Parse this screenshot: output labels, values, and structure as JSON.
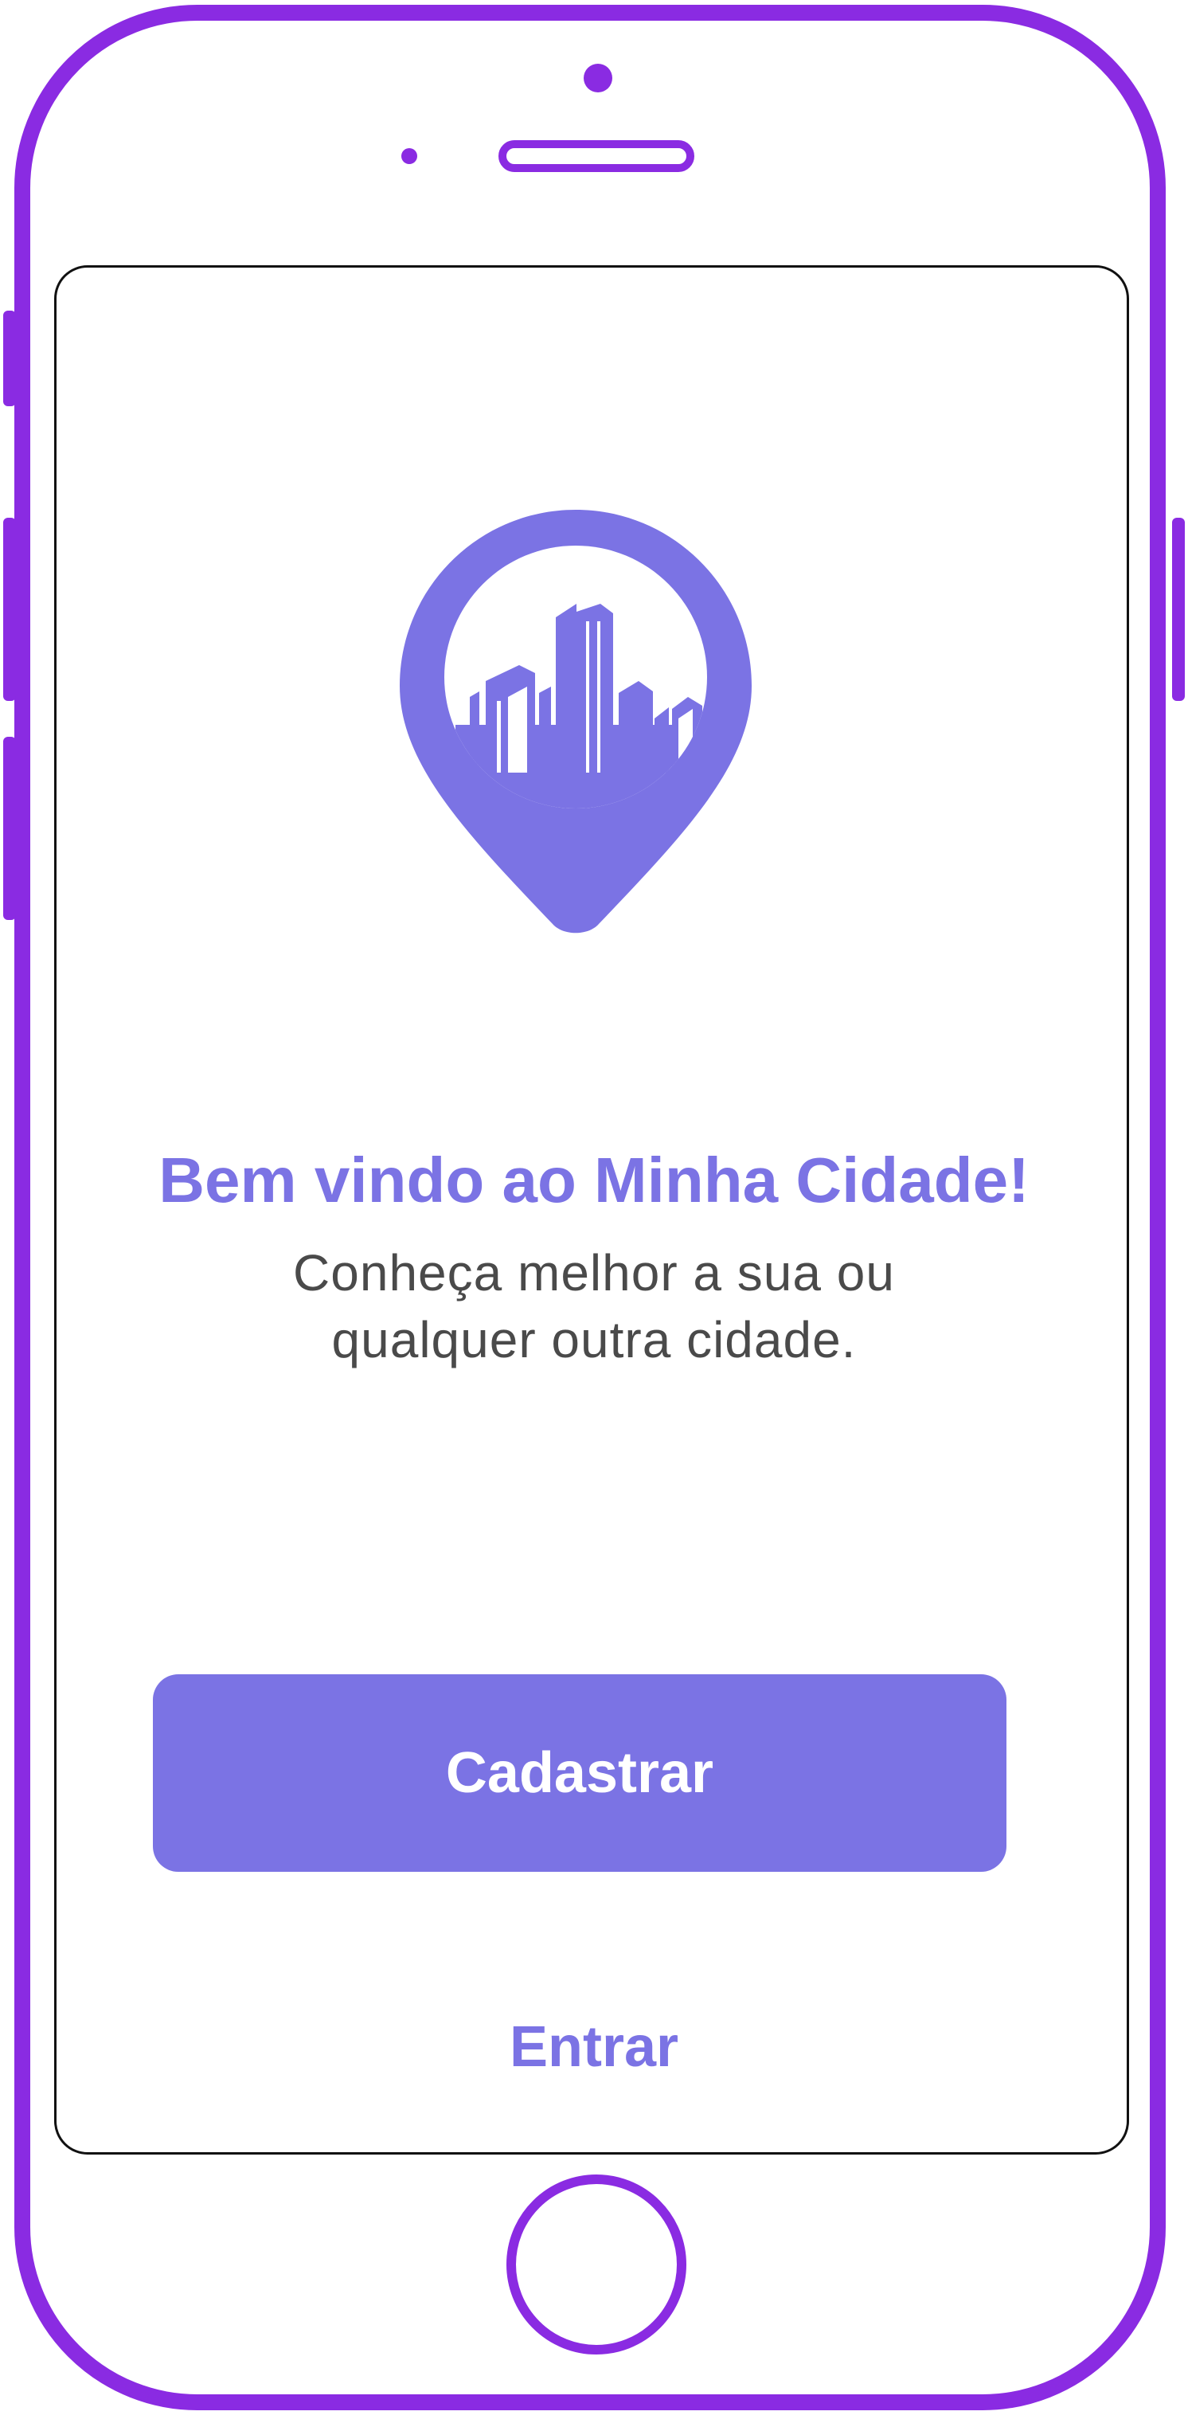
{
  "welcome": {
    "title": "Bem vindo ao Minha Cidade!",
    "subtitle_line1": "Conheça melhor a sua ou",
    "subtitle_line2": "qualquer outra cidade."
  },
  "actions": {
    "signup_label": "Cadastrar",
    "login_label": "Entrar"
  },
  "logo": {
    "icon": "city-map-pin-icon"
  },
  "colors": {
    "accent": "#7b73e4",
    "device_frame": "#8a2be2",
    "subtitle_text": "#4a4a4a"
  }
}
